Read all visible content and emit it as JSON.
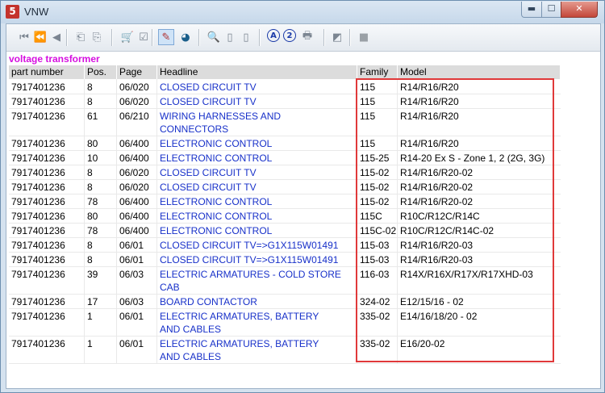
{
  "window": {
    "title": "VNW",
    "app_icon_glyph": "5",
    "controls": {
      "minimize": "▬",
      "maximize": "☐",
      "close": "✕"
    }
  },
  "toolbar": {
    "buttons": [
      {
        "name": "first-page-icon",
        "glyph": "⏮"
      },
      {
        "name": "rewind-icon",
        "glyph": "⏪"
      },
      {
        "name": "previous-icon",
        "glyph": "◀"
      },
      {
        "name": "previous-document-icon",
        "glyph": "⎗"
      },
      {
        "name": "next-document-icon",
        "glyph": "⎘"
      },
      {
        "name": "cart-icon",
        "glyph": "🛒"
      },
      {
        "name": "checklist-icon",
        "glyph": "☑"
      },
      {
        "name": "pencil-icon",
        "glyph": "✎"
      },
      {
        "name": "globe-icon",
        "glyph": "◕"
      },
      {
        "name": "zoom-icon",
        "glyph": "🔍"
      },
      {
        "name": "page-icon",
        "glyph": "▯"
      },
      {
        "name": "page-copy-icon",
        "glyph": "▯"
      },
      {
        "name": "a-icon",
        "glyph": "A"
      },
      {
        "name": "b-icon",
        "glyph": "2"
      },
      {
        "name": "print-icon",
        "glyph": "🖶"
      },
      {
        "name": "eraser-icon",
        "glyph": "◩"
      },
      {
        "name": "stop-icon",
        "glyph": "■"
      }
    ]
  },
  "section_title": "voltage transformer",
  "columns": [
    "part number",
    "Pos.",
    "Page",
    "Headline",
    "Family",
    "Model"
  ],
  "rows": [
    {
      "part": "7917401236",
      "pos": "8",
      "page": "06/020",
      "headline": [
        "CLOSED CIRCUIT TV"
      ],
      "family": "115",
      "model": "R14/R16/R20"
    },
    {
      "part": "7917401236",
      "pos": "8",
      "page": "06/020",
      "headline": [
        "CLOSED CIRCUIT TV"
      ],
      "family": "115",
      "model": "R14/R16/R20"
    },
    {
      "part": "7917401236",
      "pos": "61",
      "page": "06/210",
      "headline": [
        "WIRING HARNESSES AND",
        "CONNECTORS"
      ],
      "family": "115",
      "model": "R14/R16/R20"
    },
    {
      "part": "7917401236",
      "pos": "80",
      "page": "06/400",
      "headline": [
        "ELECTRONIC CONTROL"
      ],
      "family": "115",
      "model": "R14/R16/R20"
    },
    {
      "part": "7917401236",
      "pos": "10",
      "page": "06/400",
      "headline": [
        "ELECTRONIC CONTROL"
      ],
      "family": "115-25",
      "model": "R14-20 Ex S - Zone 1, 2 (2G, 3G)"
    },
    {
      "part": "7917401236",
      "pos": "8",
      "page": "06/020",
      "headline": [
        "CLOSED CIRCUIT TV"
      ],
      "family": "115-02",
      "model": "R14/R16/R20-02"
    },
    {
      "part": "7917401236",
      "pos": "8",
      "page": "06/020",
      "headline": [
        "CLOSED CIRCUIT TV"
      ],
      "family": "115-02",
      "model": "R14/R16/R20-02"
    },
    {
      "part": "7917401236",
      "pos": "78",
      "page": "06/400",
      "headline": [
        "ELECTRONIC CONTROL"
      ],
      "family": "115-02",
      "model": "R14/R16/R20-02"
    },
    {
      "part": "7917401236",
      "pos": "80",
      "page": "06/400",
      "headline": [
        "ELECTRONIC CONTROL"
      ],
      "family": "115C",
      "model": "R10C/R12C/R14C"
    },
    {
      "part": "7917401236",
      "pos": "78",
      "page": "06/400",
      "headline": [
        "ELECTRONIC CONTROL"
      ],
      "family": "115C-02",
      "model": "R10C/R12C/R14C-02"
    },
    {
      "part": "7917401236",
      "pos": "8",
      "page": "06/01",
      "headline": [
        "CLOSED CIRCUIT TV=>G1X115W01491"
      ],
      "family": "115-03",
      "model": "R14/R16/R20-03"
    },
    {
      "part": "7917401236",
      "pos": "8",
      "page": "06/01",
      "headline": [
        "CLOSED CIRCUIT TV=>G1X115W01491"
      ],
      "family": "115-03",
      "model": "R14/R16/R20-03"
    },
    {
      "part": "7917401236",
      "pos": "39",
      "page": "06/03",
      "headline": [
        "ELECTRIC ARMATURES - COLD STORE",
        "CAB"
      ],
      "family": "116-03",
      "model": "R14X/R16X/R17X/R17XHD-03"
    },
    {
      "part": "7917401236",
      "pos": "17",
      "page": "06/03",
      "headline": [
        "BOARD CONTACTOR"
      ],
      "family": "324-02",
      "model": "E12/15/16 - 02"
    },
    {
      "part": "7917401236",
      "pos": "1",
      "page": "06/01",
      "headline": [
        "ELECTRIC ARMATURES, BATTERY",
        "AND CABLES"
      ],
      "family": "335-02",
      "model": "E14/16/18/20 - 02"
    },
    {
      "part": "7917401236",
      "pos": "1",
      "page": "06/01",
      "headline": [
        "ELECTRIC ARMATURES, BATTERY",
        "AND CABLES"
      ],
      "family": "335-02",
      "model": "E16/20-02"
    }
  ],
  "colors": {
    "section_title": "#d60fe0",
    "link": "#1730c9",
    "highlight_box": "#e0393a"
  }
}
